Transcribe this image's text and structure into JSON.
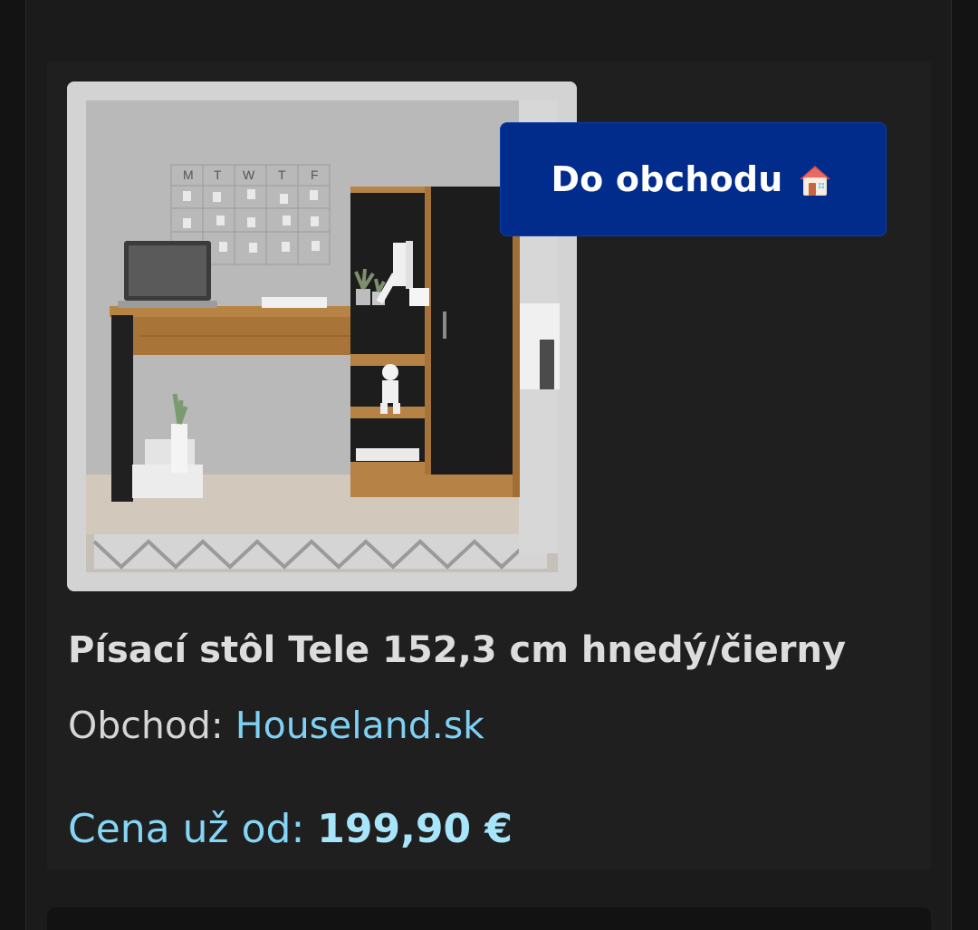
{
  "product": {
    "image_alt": "Písací stôl Tele 152,3 cm hnedý/čierny",
    "title": "Písací stôl Tele 152,3 cm hnedý/čierny",
    "shop_prefix": "Obchod: ",
    "shop_name": "Houseland.sk",
    "price_prefix": "Cena už od: ",
    "price": "199,90 €"
  },
  "actions": {
    "shop_button_label": "Do obchodu",
    "shop_button_icon": "house-emoji-icon"
  },
  "planner": {
    "days": [
      "M",
      "T",
      "W",
      "T",
      "F"
    ]
  },
  "colors": {
    "background": "#131313",
    "card": "#1f1f1f",
    "button": "#022c8c",
    "link": "#7fd0f3",
    "price": "#85d6f6"
  }
}
